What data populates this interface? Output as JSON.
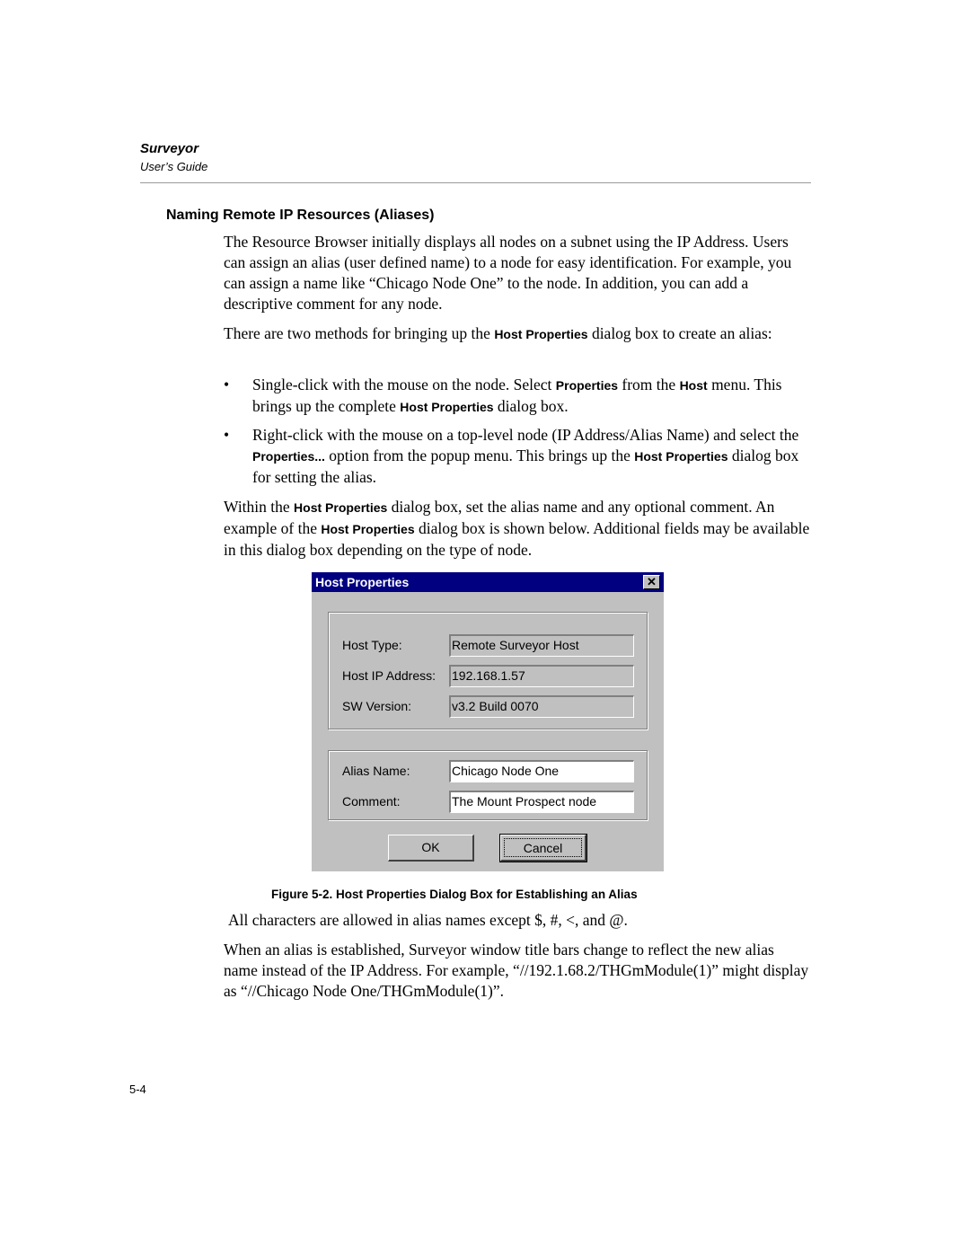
{
  "running_head": {
    "title": "Surveyor",
    "subtitle": "User’s Guide"
  },
  "section": {
    "heading": "Naming Remote IP Resources (Aliases)"
  },
  "paragraphs": {
    "p1": "The Resource Browser initially displays all nodes on a subnet using the IP Address. Users can assign an alias (user defined name) to a node for easy identification. For example, you can assign a name like “Chicago Node One” to the node. In addition, you can add a descriptive comment for any node.",
    "p2_a": "There are two methods for bringing up the ",
    "p2_ui": "Host Properties",
    "p2_b": " dialog box to create an alias:",
    "p3_a": "Within the ",
    "p3_ui1": "Host Properties",
    "p3_b": " dialog box, set the alias name and any optional comment. An example of the ",
    "p3_ui2": "Host Properties",
    "p3_c": " dialog box is shown below. Additional fields may be available in this dialog box depending on the type of node.",
    "p4": "All characters are allowed in alias names except $, #, <, and @.",
    "p5": "When an alias is established, Surveyor window title bars change to reflect the new alias name instead of the IP Address. For example, “//192.1.68.2/THGmModule(1)” might display as “//Chicago Node One/THGmModule(1)”."
  },
  "bullets": [
    {
      "symbol": "•",
      "t1": "Single-click with the mouse on the node. Select ",
      "u1": "Properties",
      "t2": " from the ",
      "u2": "Host",
      "t3": " menu. This brings up the complete ",
      "u3": "Host Properties",
      "t4": " dialog box."
    },
    {
      "symbol": "•",
      "t1": "Right-click with the mouse on a top-level node (IP Address/Alias Name) and select the ",
      "u1": "Properties...",
      "t2": " option from the popup menu. This brings up the ",
      "u2": "Host Properties",
      "t3": " dialog box for setting the alias."
    }
  ],
  "dialog": {
    "title": "Host Properties",
    "close_glyph": "✕",
    "title_bg": "#000080",
    "face_color": "#c0c0c0",
    "group1": [
      {
        "label": "Host Type:",
        "value": "Remote Surveyor Host"
      },
      {
        "label": "Host IP Address:",
        "value": "192.168.1.57"
      },
      {
        "label": "SW Version:",
        "value": "v3.2  Build 0070"
      }
    ],
    "group2": [
      {
        "label": "Alias Name:",
        "value": "Chicago Node One"
      },
      {
        "label": "Comment:",
        "value": "The Mount Prospect node"
      }
    ],
    "ok_label": "OK",
    "cancel_label": "Cancel"
  },
  "figure": {
    "caption": "Figure 5-2.  Host Properties Dialog Box for Establishing an Alias"
  },
  "page_number": "5-4"
}
